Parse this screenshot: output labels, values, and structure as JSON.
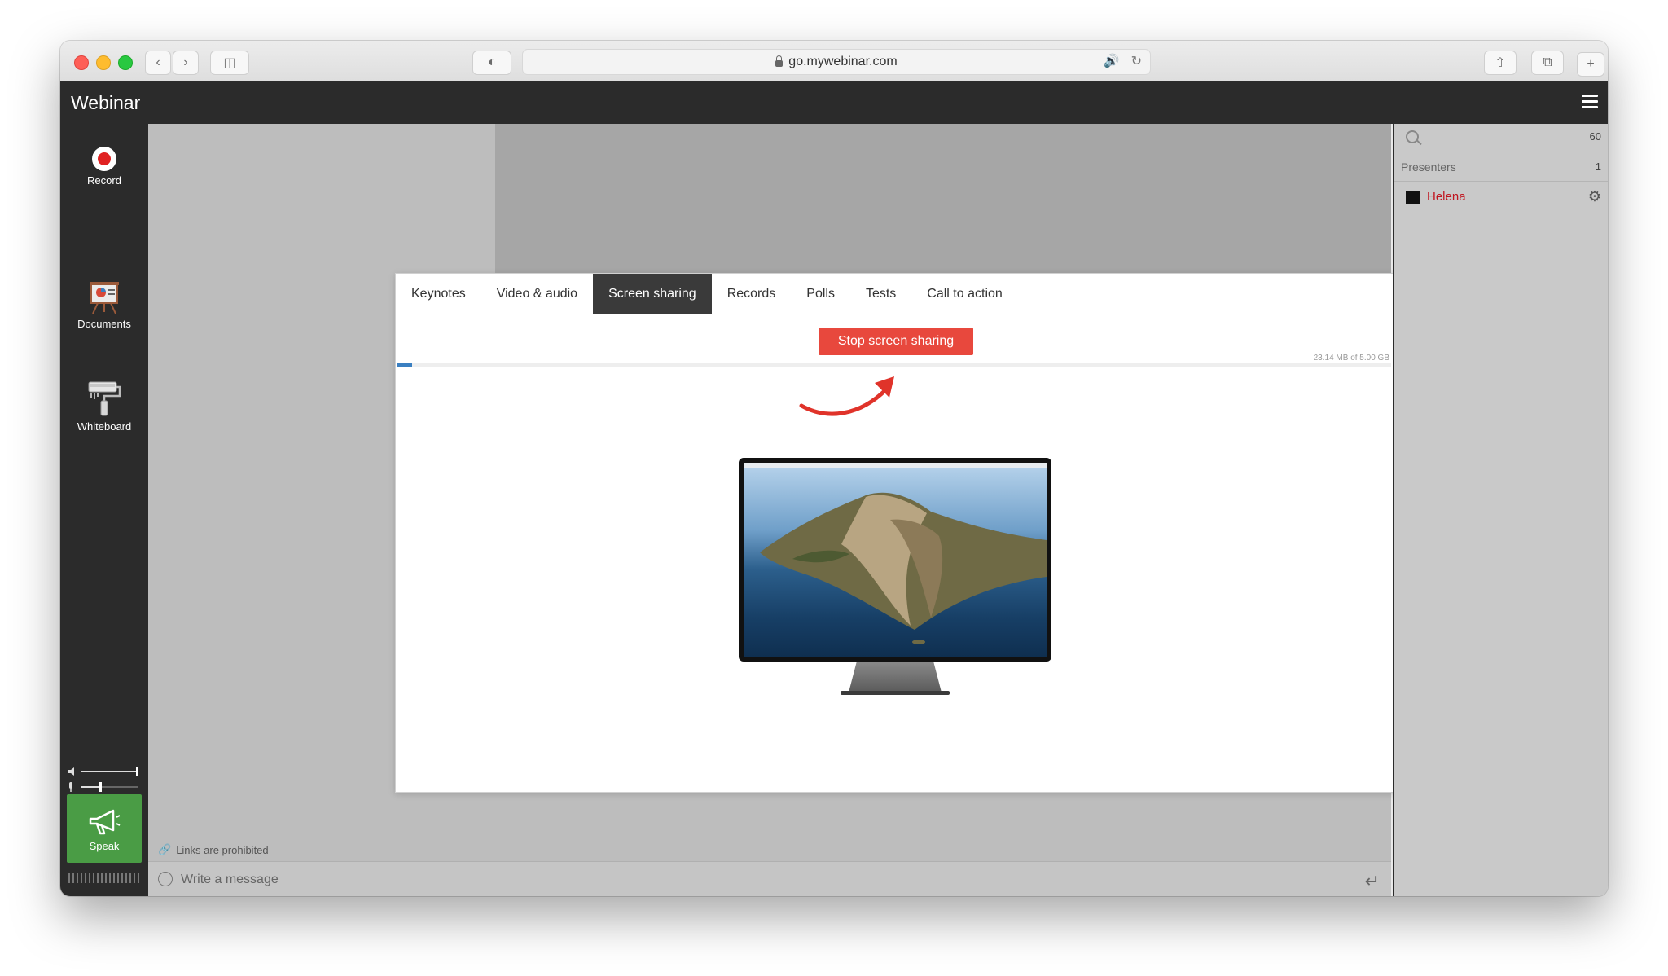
{
  "browser": {
    "url": "go.mywebinar.com"
  },
  "app": {
    "title": "Webinar"
  },
  "sidebar": {
    "tools": [
      {
        "label": "Record"
      },
      {
        "label": "Documents"
      },
      {
        "label": "Whiteboard"
      }
    ],
    "speak_label": "Speak"
  },
  "modal": {
    "tabs": [
      {
        "label": "Keynotes",
        "active": false
      },
      {
        "label": "Video & audio",
        "active": false
      },
      {
        "label": "Screen sharing",
        "active": true
      },
      {
        "label": "Records",
        "active": false
      },
      {
        "label": "Polls",
        "active": false
      },
      {
        "label": "Tests",
        "active": false
      },
      {
        "label": "Call to action",
        "active": false
      }
    ],
    "stop_button_label": "Stop screen sharing",
    "storage_text": "23.14 MB of 5.00 GB",
    "storage_fraction": 0.015
  },
  "chat": {
    "links_note": "Links are prohibited",
    "placeholder": "Write a message"
  },
  "participants": {
    "count": "60",
    "presenters_label": "Presenters",
    "presenters_count": "1",
    "presenter_name": "Helena"
  },
  "colors": {
    "accent_red": "#e8483d",
    "speak_green": "#4a9c45",
    "presenter_name": "#c0151f"
  }
}
